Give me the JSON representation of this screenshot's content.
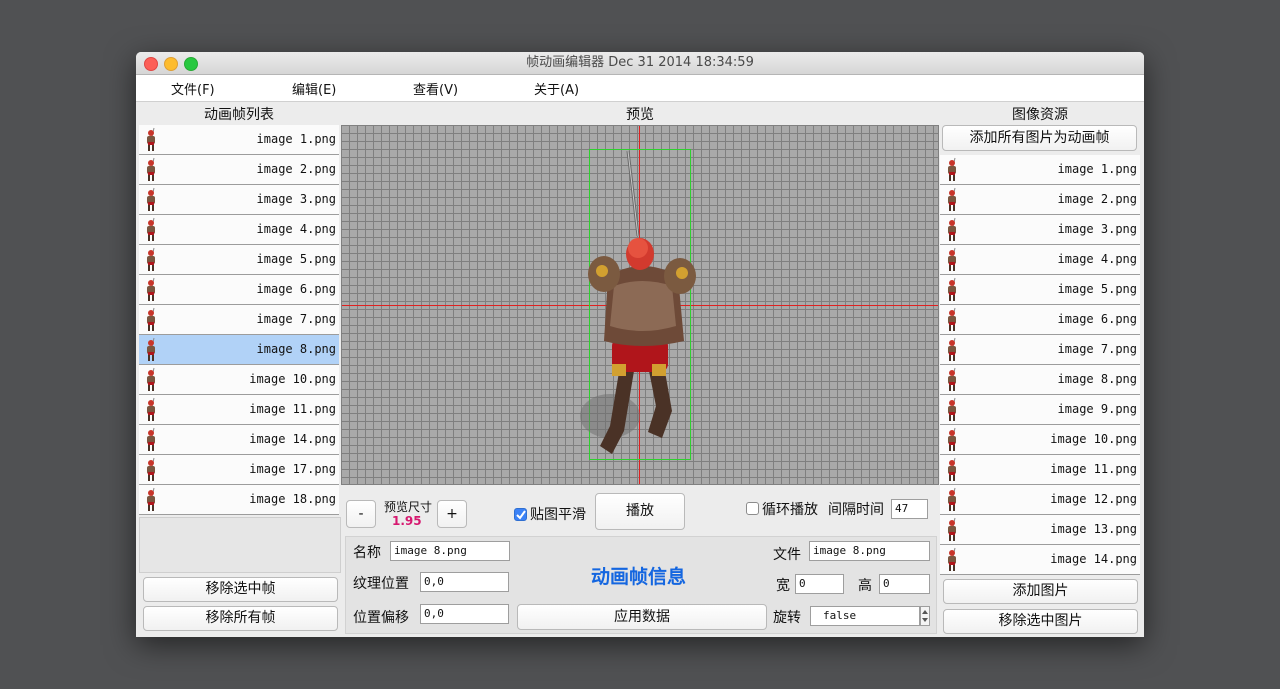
{
  "window": {
    "title": "帧动画编辑器 Dec 31 2014 18:34:59"
  },
  "menu": {
    "items": [
      "文件(F)",
      "编辑(E)",
      "查看(V)",
      "关于(A)"
    ]
  },
  "frame_panel": {
    "header": "动画帧列表",
    "items": [
      {
        "label": "image 1.png"
      },
      {
        "label": "image 2.png"
      },
      {
        "label": "image 3.png"
      },
      {
        "label": "image 4.png"
      },
      {
        "label": "image 5.png"
      },
      {
        "label": "image 6.png"
      },
      {
        "label": "image 7.png"
      },
      {
        "label": "image 8.png"
      },
      {
        "label": "image 10.png"
      },
      {
        "label": "image 11.png"
      },
      {
        "label": "image 14.png"
      },
      {
        "label": "image 17.png"
      },
      {
        "label": "image 18.png"
      }
    ],
    "selected_label": "image 8.png",
    "remove_selected_label": "移除选中帧",
    "remove_all_label": "移除所有帧"
  },
  "preview": {
    "header": "预览",
    "size_label": "预览尺寸",
    "size_value": "1.95",
    "minus_label": "-",
    "plus_label": "+",
    "smooth_label": "贴图平滑",
    "smooth_checked": true,
    "play_label": "播放",
    "loop_label": "循环播放",
    "loop_checked": false,
    "interval_label": "间隔时间",
    "interval_value": "47"
  },
  "frame_info": {
    "title": "动画帧信息",
    "name_label": "名称",
    "name_value": "image 8.png",
    "texture_label": "纹理位置",
    "texture_value": "0,0",
    "offset_label": "位置偏移",
    "offset_value": "0,0",
    "apply_label": "应用数据",
    "file_label": "文件",
    "file_value": "image 8.png",
    "width_label": "宽",
    "width_value": "0",
    "height_label": "高",
    "height_value": "0",
    "rotate_label": "旋转",
    "rotate_value": "false"
  },
  "resource_panel": {
    "header": "图像资源",
    "add_all_label": "添加所有图片为动画帧",
    "items": [
      {
        "label": "image 1.png"
      },
      {
        "label": "image 2.png"
      },
      {
        "label": "image 3.png"
      },
      {
        "label": "image 4.png"
      },
      {
        "label": "image 5.png"
      },
      {
        "label": "image 6.png"
      },
      {
        "label": "image 7.png"
      },
      {
        "label": "image 8.png"
      },
      {
        "label": "image 9.png"
      },
      {
        "label": "image 10.png"
      },
      {
        "label": "image 11.png"
      },
      {
        "label": "image 12.png"
      },
      {
        "label": "image 13.png"
      },
      {
        "label": "image 14.png"
      }
    ],
    "add_image_label": "添加图片",
    "remove_image_label": "移除选中图片"
  },
  "colors": {
    "selected_row": "#b1d2f7",
    "size_value": "#d6186f",
    "info_title": "#1466e0",
    "axis": "#e02020",
    "bbox": "#2ed12e"
  },
  "icons": {
    "frame_thumbnail": "warrior-sprite-icon",
    "checkbox_checked": "checkmark-icon",
    "stepper": "stepper-arrows-icon"
  }
}
